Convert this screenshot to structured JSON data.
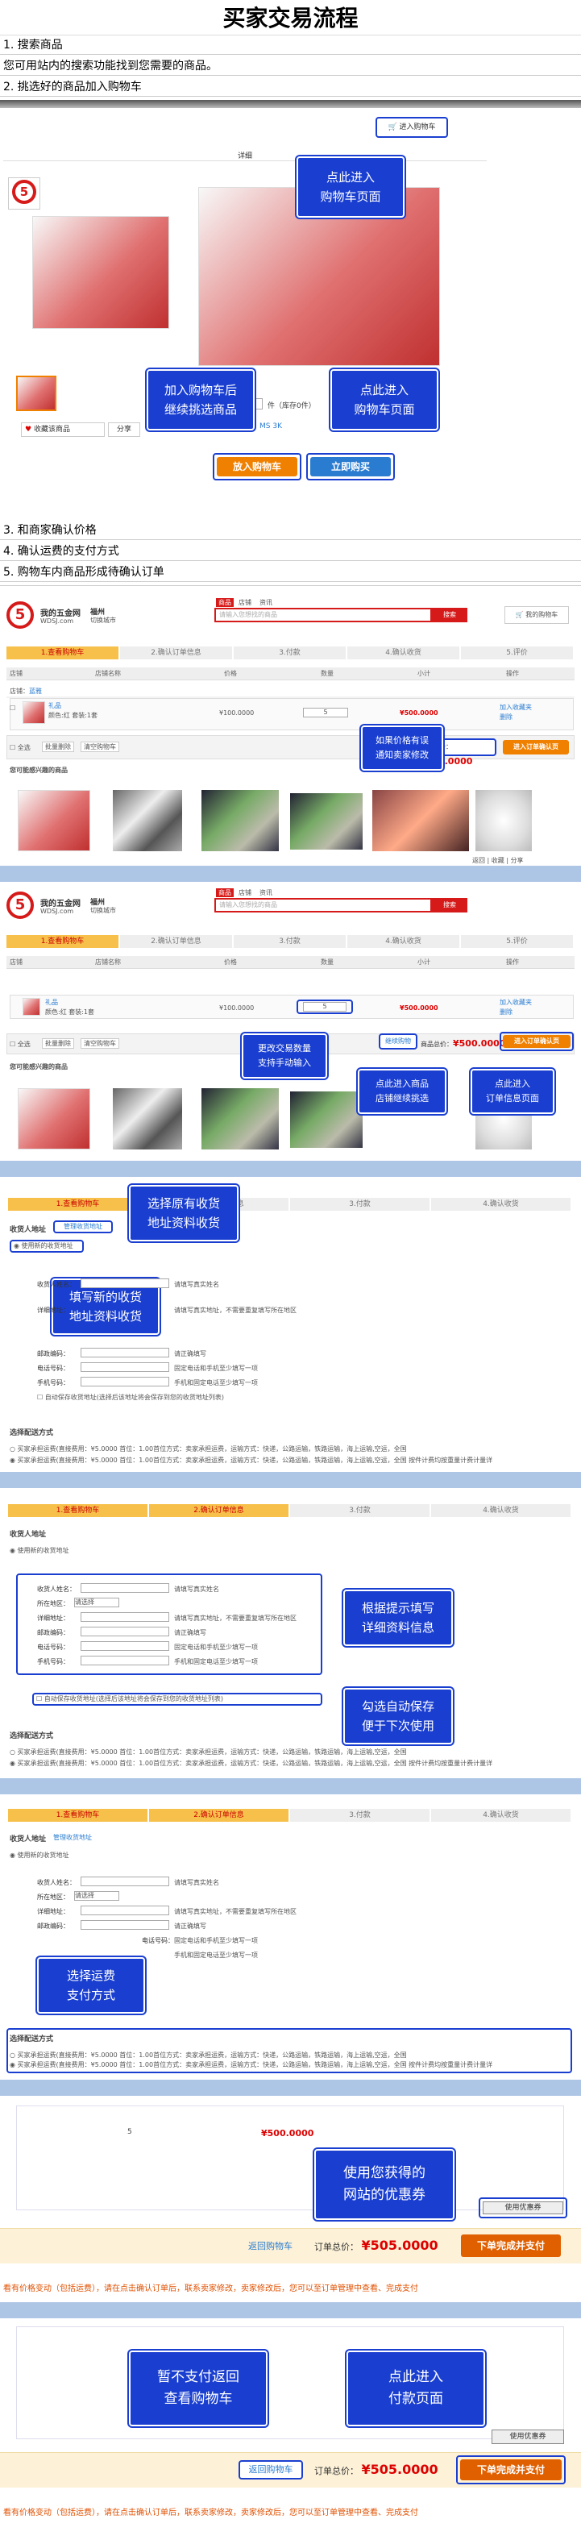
{
  "page": {
    "title": "买家交易流程"
  },
  "steps": {
    "s1": "1. 搜索商品",
    "s1_desc": "您可用站内的搜索功能找到您需要的商品。",
    "s2": "2. 挑选好的商品加入购物车",
    "s3": "3. 和商家确认价格",
    "s4": "4. 确认运费的支付方式",
    "s5": "5. 购物车内商品形成待确认订单"
  },
  "product": {
    "cart_top": "进入购物车",
    "detail_tab": "详细",
    "qty_label": "件（库存0件）",
    "price_tag": "MS 3K",
    "fav": "收藏该商品",
    "share": "分享",
    "add_cart": "放入购物车",
    "buy_now": "立即购买"
  },
  "callouts": {
    "c1": "点此进入\n购物车页面",
    "c2": "加入购物车后\n继续挑选商品",
    "c3": "点此进入\n购物车页面",
    "c4": "如果价格有误\n通知卖家修改",
    "c5": "更改交易数量\n支持手动输入",
    "c6": "点此进入商品\n店铺继续挑选",
    "c7": "点此进入\n订单信息页面",
    "c8": "选择原有收货\n地址资料收货",
    "c9": "填写新的收货\n地址资料收货",
    "c10": "根据提示填写\n详细资料信息",
    "c11": "勾选自动保存\n便于下次使用",
    "c12": "选择运费\n支付方式",
    "c13": "使用您获得的\n网站的优惠券",
    "c14": "暂不支付返回\n查看购物车",
    "c15": "点此进入\n付款页面"
  },
  "site": {
    "logo": "5",
    "name": "我的五金网",
    "domain": "WDSJ.com",
    "city": "福州",
    "city_sub": "切换城市",
    "search_tabs": [
      "商品",
      "店铺",
      "资讯"
    ],
    "search_ph": "请输入您想找的商品",
    "search_btn": "搜索",
    "my_cart": "我的购物车"
  },
  "cart": {
    "steps": [
      "1.查看购物车",
      "2.确认订单信息",
      "3.付款",
      "4.确认收货",
      "5.评价"
    ],
    "headers": [
      "店铺",
      "店铺名称",
      "价格",
      "数量",
      "小计",
      "操作"
    ],
    "shop_label": "店铺：",
    "shop_name": "蓝雅",
    "item_name": "礼品",
    "item_sub": "颜色:红 套装:1套",
    "price": "¥100.0000",
    "qty": "5",
    "subtotal": "¥500.0000",
    "ops": [
      "加入收藏夹",
      "删除"
    ],
    "select_all": "全选",
    "del_sel": "批量删除",
    "clear": "清空购物车",
    "continue": "继续购物",
    "total_label": "商品总价：",
    "total": "¥500.0000",
    "checkout": "进入订单确认页",
    "rec_title": "您可能感兴趣的商品",
    "mini_tools": [
      "返回",
      "收藏",
      "分享"
    ]
  },
  "order": {
    "steps": [
      "1.查看购物车",
      "2.确认订单信息",
      "3.付款",
      "4.确认收货"
    ],
    "addr_title": "收货人地址",
    "addr_mgr": "管理收货地址",
    "use_new": "使用新的收货地址",
    "labels": [
      "收货人姓名：",
      "所在地区：",
      "详细地址：",
      "邮政编码：",
      "电话号码：",
      "手机号码："
    ],
    "hints": [
      "请填写真实姓名",
      "",
      "请填写真实地址，不需要重复填写所在地区",
      "请正确填写",
      "固定电话和手机至少填写一项",
      "手机和固定电话至少填写一项"
    ],
    "region_sel": "请选择",
    "autosave": "自动保存收货地址(选择后该地址将会保存到您的收货地址列表)",
    "ship_title": "选择配送方式",
    "ship1": "买家承担运费(直接费用：¥5.0000 首位：1.00首位方式：卖家承担运费，运输方式：快递，公路运输，铁路运输，海上运输,空运，全国",
    "ship2": "买家承担运费(直接费用：¥5.0000 首位：1.00首位方式：卖家承担运费，运输方式：快递，公路运输，铁路运输，海上运输,空运，全国 按件计费均按重量计费计量详",
    "coupon_btn": "使用优惠券",
    "back_cart": "返回购物车",
    "total_label": "订单总价：",
    "total": "¥505.0000",
    "submit": "下单完成并支付",
    "notice": "看有价格变动（包括运费），请在点击确认订单后，联系卖家修改，卖家修改后，您可以至订单管理中查看、完成支付",
    "qty_small": "5",
    "sub_small": "¥500.0000"
  }
}
